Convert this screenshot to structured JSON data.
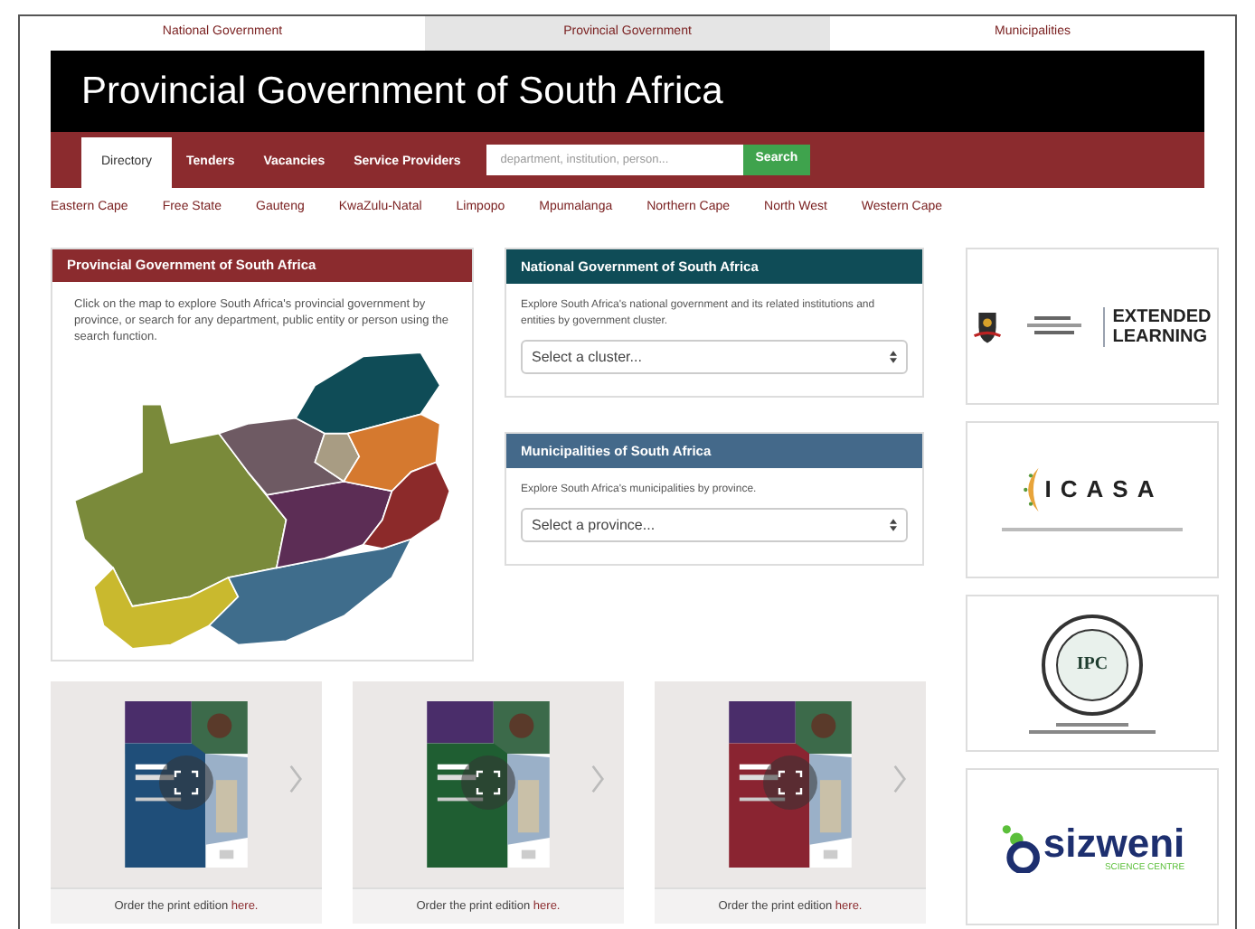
{
  "top_tabs": [
    {
      "label": "National Government",
      "selected": false
    },
    {
      "label": "Provincial Government",
      "selected": true
    },
    {
      "label": "Municipalities",
      "selected": false
    }
  ],
  "header": {
    "title": "Provincial Government of South Africa"
  },
  "nav": {
    "items": [
      {
        "label": "Directory",
        "selected": true
      },
      {
        "label": "Tenders",
        "selected": false
      },
      {
        "label": "Vacancies",
        "selected": false
      },
      {
        "label": "Service Providers",
        "selected": false
      }
    ],
    "search": {
      "placeholder": "department, institution, person...",
      "button": "Search"
    }
  },
  "provinces": [
    "Eastern Cape",
    "Free State",
    "Gauteng",
    "KwaZulu-Natal",
    "Limpopo",
    "Mpumalanga",
    "Northern Cape",
    "North West",
    "Western Cape"
  ],
  "map_card": {
    "title": "Provincial Government of South Africa",
    "text": "Click on the map to explore South Africa's provincial government by province, or search for any department, public entity or person using the search function."
  },
  "cards": [
    {
      "title": "National Government of South Africa",
      "color": "#0f4c57",
      "text": "Explore South Africa's national government and its related institutions and entities by government cluster.",
      "select": "Select a cluster..."
    },
    {
      "title": "Municipalities of South Africa",
      "color": "#44698a",
      "text": "Explore South Africa's municipalities by province.",
      "select": "Select a province..."
    }
  ],
  "logos": [
    {
      "kind": "extended_learning",
      "lines": [
        "EXTENDED",
        "LEARNING"
      ]
    },
    {
      "kind": "icasa",
      "text": "ICASA"
    },
    {
      "kind": "ipc",
      "text": "IPC"
    },
    {
      "kind": "asizweni",
      "text": "sizweni",
      "subtext": "SCIENCE CENTRE"
    }
  ],
  "publications": [
    {
      "color": "#1f4e79",
      "caption": "Order the print edition ",
      "link": "here."
    },
    {
      "color": "#1f5e32",
      "caption": "Order the print edition ",
      "link": "here."
    },
    {
      "color": "#8a2431",
      "caption": "Order the print edition ",
      "link": "here."
    }
  ]
}
